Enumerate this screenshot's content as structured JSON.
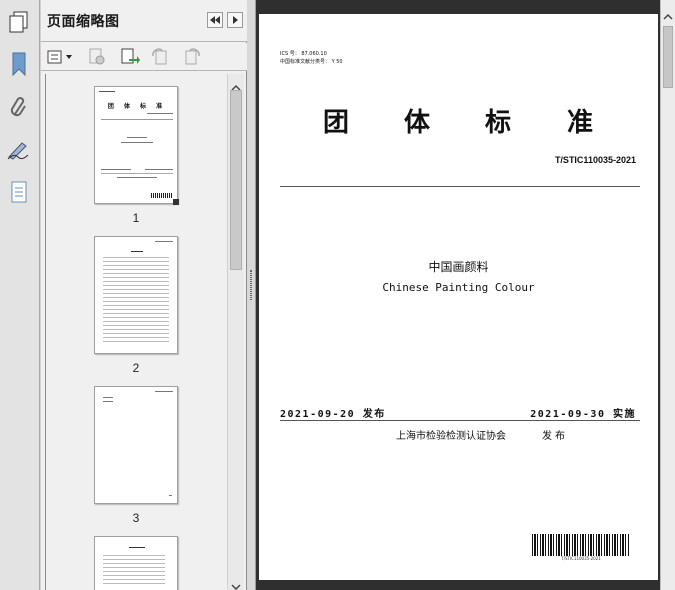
{
  "panel": {
    "title": "页面缩略图",
    "icons": {
      "pages": "pages-icon",
      "rewind": "rewind-icon",
      "forward": "forward-icon",
      "options": "options-menu-icon",
      "delete": "delete-page-icon",
      "insert": "insert-page-icon",
      "rotate_ccw": "rotate-ccw-icon",
      "rotate_cw": "rotate-cw-icon"
    },
    "thumbnails": [
      {
        "number": "1"
      },
      {
        "number": "2"
      },
      {
        "number": "3"
      }
    ],
    "thumb1_title": "团 体 标 准"
  },
  "sidebar_icons": [
    "bookmark-icon",
    "attachment-icon",
    "signature-icon",
    "layers-icon"
  ],
  "document": {
    "ics": "ICS 号： 87.060.10",
    "classification": "中国标准文献分类号： Y 50",
    "title_chars": [
      "团",
      "体",
      "标",
      "准"
    ],
    "code": "T/STIC110035-2021",
    "title_cn": "中国画颜料",
    "title_en": "Chinese Painting Colour",
    "publish_date": "2021-09-20 发布",
    "implement_date": "2021-09-30 实施",
    "issuer": "上海市检验检测认证协会",
    "issue_word": "发布",
    "barcode_text": "T/STIC110035-2021"
  },
  "colors": {
    "viewer_bg": "#2f2f2f",
    "panel_bg": "#f0f0f0"
  }
}
